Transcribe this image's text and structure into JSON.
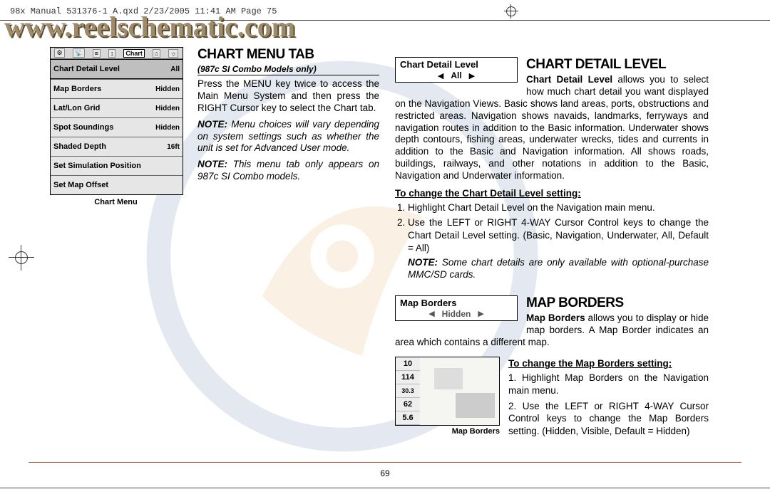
{
  "print_header": "98x Manual 531376-1 A.qxd  2/23/2005  11:41 AM  Page 75",
  "watermark_url": "www.reelschematic.com",
  "page_number": "69",
  "chartmenu": {
    "tabs": [
      "⚙",
      "📡",
      "≡",
      "↕",
      "Chart",
      "⌂",
      "☼"
    ],
    "rows": [
      {
        "label": "Chart Detail Level",
        "value": "All",
        "hl": true
      },
      {
        "label": "Map Borders",
        "value": "Hidden"
      },
      {
        "label": "Lat/Lon Grid",
        "value": "Hidden"
      },
      {
        "label": "Spot Soundings",
        "value": "Hidden"
      },
      {
        "label": "Shaded Depth",
        "value": "16ft"
      },
      {
        "label": "Set Simulation Position",
        "value": ""
      },
      {
        "label": "Set Map Offset",
        "value": ""
      }
    ],
    "caption": "Chart Menu"
  },
  "mid": {
    "title": "CHART MENU TAB",
    "subtitle": "(987c SI Combo Models only)",
    "para": "Press the MENU key twice to access the Main Menu System and then press the RIGHT Cursor key to select the Chart tab.",
    "note1_label": "NOTE:",
    "note1": " Menu choices will vary depending on system settings such as whether the unit is set for Advanced User mode.",
    "note2_label": "NOTE:",
    "note2": " This menu tab only appears on 987c SI Combo models."
  },
  "right": {
    "cdl": {
      "box_label": "Chart Detail Level",
      "box_value": "All",
      "title": "CHART DETAIL LEVEL",
      "lead_strong": "Chart Detail Level",
      "lead": " allows you to select how much chart detail you want displayed on the Navigation Views. Basic shows land areas, ports, obstructions and restricted areas. Navigation shows navaids, landmarks, ferryways and navigation routes in addition to the Basic information. Underwater shows depth contours, fishing areas, underwater wrecks, tides and currents in addition to the Basic and Navigation information. All shows roads, buildings, railways, and other notations in addition to the Basic, Navigation and Underwater information.",
      "instr_head": "To change the Chart Detail Level setting:",
      "steps": [
        "Highlight Chart Detail Level on the Navigation main menu.",
        "Use the LEFT or RIGHT 4-WAY Cursor Control keys to change the Chart Detail Level setting. (Basic, Navigation, Underwater, All, Default = All)"
      ],
      "note_label": "NOTE:",
      "note": " Some chart details are only available with optional-purchase MMC/SD cards."
    },
    "mb": {
      "box_label": "Map Borders",
      "box_value": "Hidden",
      "title": "MAP BORDERS",
      "lead_strong": "Map Borders",
      "lead": " allows you to display or hide map borders. A Map Border indicates an area which contains a different map.",
      "instr_head": "To change the Map Borders setting:",
      "steps": [
        "Highlight Map Borders on the Navigation main menu.",
        "Use the LEFT or RIGHT 4-WAY Cursor Control keys to change the Map Borders setting. (Hidden, Visible, Default = Hidden)"
      ],
      "thumb_caption": "Map Borders",
      "side_values": [
        "10",
        "114",
        "30.3",
        "62",
        "5.6"
      ]
    }
  }
}
